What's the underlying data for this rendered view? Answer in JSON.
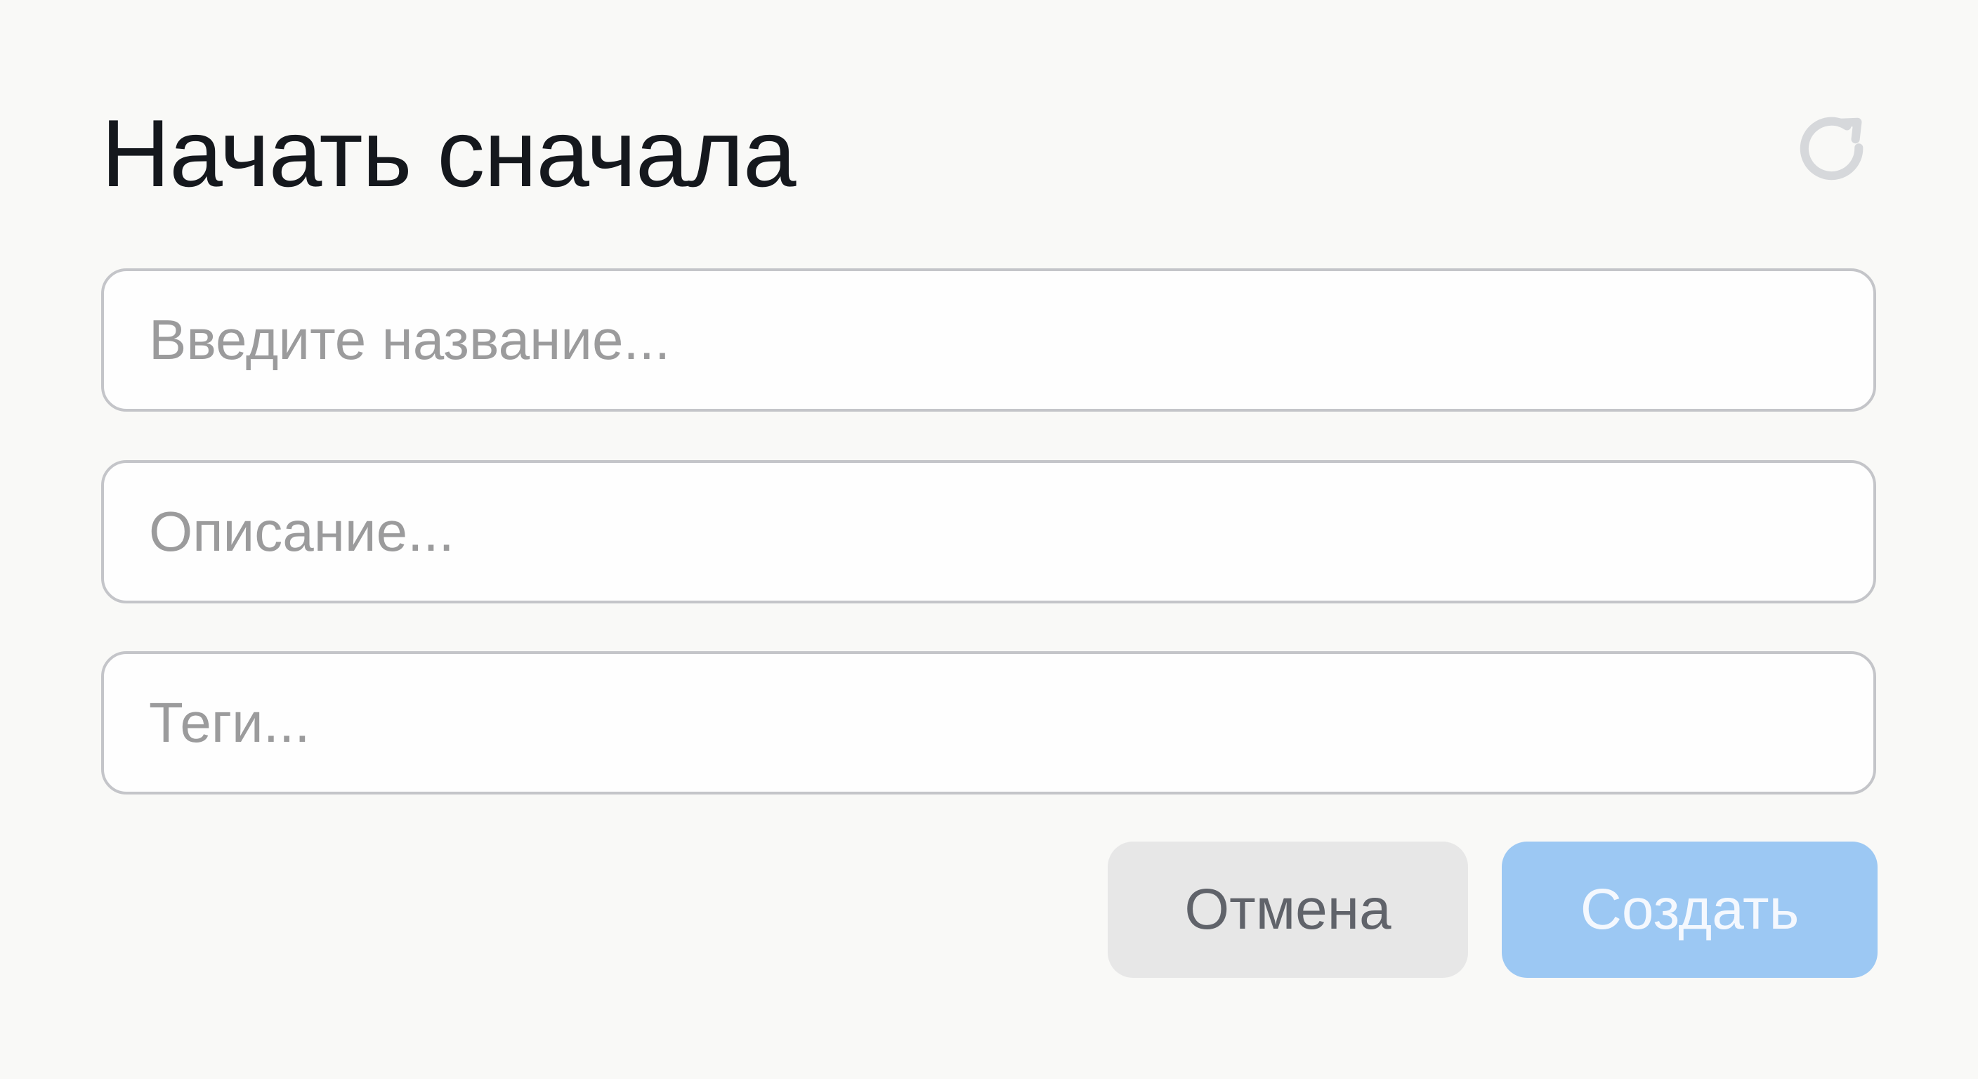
{
  "dialog": {
    "title": "Начать сначала",
    "reset_icon": "refresh-icon",
    "fields": {
      "name": {
        "value": "",
        "placeholder": "Введите название..."
      },
      "description": {
        "value": "",
        "placeholder": "Описание..."
      },
      "tags": {
        "value": "",
        "placeholder": "Теги..."
      }
    },
    "buttons": {
      "cancel_label": "Отмена",
      "create_label": "Создать",
      "create_disabled": true
    },
    "colors": {
      "background": "#f9f9f7",
      "title": "#15181d",
      "field_border": "#c4c5c9",
      "placeholder": "#9b9b9c",
      "cancel_bg": "#e7e7e7",
      "cancel_text": "#60636a",
      "create_bg": "#9cc8f3",
      "create_text": "#f4f8fe",
      "icon": "#d6d8db"
    }
  }
}
